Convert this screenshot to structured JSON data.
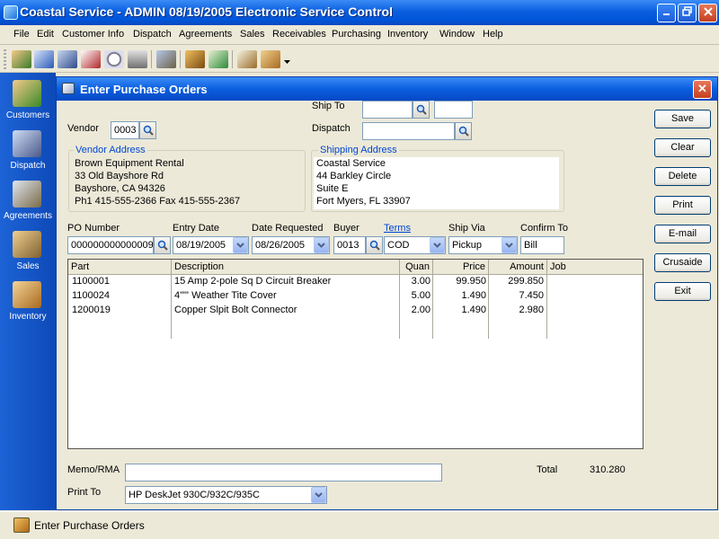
{
  "window": {
    "title": "Coastal Service - ADMIN 08/19/2005 Electronic Service Control"
  },
  "menu": [
    "File",
    "Edit",
    "Customer Info",
    "Dispatch",
    "Agreements",
    "Sales",
    "Receivables",
    "Purchasing",
    "Inventory",
    "Window",
    "Help"
  ],
  "toolbar": {
    "icons": [
      "customers-icon",
      "contacts-icon",
      "dispatch-icon",
      "calendar-icon",
      "schedule-icon",
      "printer-icon",
      "agreements-icon",
      "sales-register-icon",
      "ledger-icon",
      "reports-icon",
      "inventory-box-icon",
      "more-icon"
    ]
  },
  "sidebar": [
    {
      "label": "Customers",
      "icon": "customers-icon"
    },
    {
      "label": "Dispatch",
      "icon": "dispatch-icon"
    },
    {
      "label": "Agreements",
      "icon": "agreements-icon"
    },
    {
      "label": "Sales",
      "icon": "sales-register-icon"
    },
    {
      "label": "Inventory",
      "icon": "inventory-box-icon"
    }
  ],
  "form": {
    "title": "Enter Purchase Orders",
    "close": "✕",
    "vendor": {
      "label": "Vendor",
      "value": "0003"
    },
    "ship_to": {
      "label": "Ship To",
      "value1": "",
      "value2": ""
    },
    "dispatch": {
      "label": "Dispatch",
      "value": ""
    },
    "vendor_address": {
      "title": "Vendor Address",
      "lines": [
        "Brown Equipment Rental",
        "33 Old Bayshore Rd",
        "Bayshore, CA  94326",
        "Ph1 415-555-2366  Fax 415-555-2367"
      ]
    },
    "shipping_address": {
      "title": "Shipping Address",
      "lines": [
        "Coastal Service",
        "44 Barkley Circle",
        "Suite E",
        "Fort Myers, FL  33907"
      ]
    },
    "po_number": {
      "label": "PO Number",
      "value": "000000000000009"
    },
    "entry_date": {
      "label": "Entry Date",
      "value": "08/19/2005"
    },
    "date_requested": {
      "label": "Date Requested",
      "value": "08/26/2005"
    },
    "buyer": {
      "label": "Buyer",
      "value": "0013"
    },
    "terms": {
      "label": "Terms",
      "value": "COD"
    },
    "ship_via": {
      "label": "Ship Via",
      "value": "Pickup"
    },
    "confirm_to": {
      "label": "Confirm To",
      "value": "Bill"
    },
    "grid": {
      "columns": [
        "Part",
        "Description",
        "Quan",
        "Price",
        "Amount",
        "Job"
      ],
      "rows": [
        {
          "part": "1100001",
          "description": "15 Amp 2-pole Sq D Circuit Breaker",
          "quan": "3.00",
          "price": "99.950",
          "amount": "299.850",
          "job": ""
        },
        {
          "part": "1100024",
          "description": "4\"\"' Weather Tite Cover",
          "quan": "5.00",
          "price": "1.490",
          "amount": "7.450",
          "job": ""
        },
        {
          "part": "1200019",
          "description": "Copper Slpit Bolt Connector",
          "quan": "2.00",
          "price": "1.490",
          "amount": "2.980",
          "job": ""
        }
      ]
    },
    "memo": {
      "label": "Memo/RMA",
      "value": ""
    },
    "total": {
      "label": "Total",
      "value": "310.280"
    },
    "print_to": {
      "label": "Print To",
      "value": "HP DeskJet 930C/932C/935C"
    },
    "buttons": [
      "Save",
      "Clear",
      "Delete",
      "Print",
      "E-mail",
      "Crusaide",
      "Exit"
    ]
  },
  "taskbar": {
    "item": "Enter Purchase Orders"
  },
  "colors": {
    "titlebar": "#0a5fe0",
    "sidebar": "#1d63d6",
    "link": "#0046d5",
    "close": "#c4401e"
  }
}
